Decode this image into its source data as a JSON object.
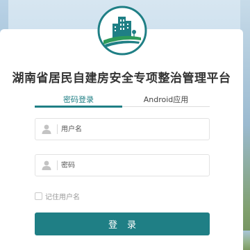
{
  "app": {
    "title": "湖南省居民自建房安全专项整治管理平台"
  },
  "tabs": {
    "password_login": "密码登录",
    "android_app": "Android应用"
  },
  "form": {
    "username_placeholder": "用户名",
    "password_placeholder": "密码",
    "remember_label": "记住用户名",
    "login_label": "登录"
  },
  "colors": {
    "accent": "#1f7f85",
    "title": "#333333",
    "placeholder": "#555555",
    "remember": "#9a9a9a"
  },
  "icons": {
    "logo": "building-logo-icon",
    "username": "user-icon",
    "password": "user-icon"
  }
}
